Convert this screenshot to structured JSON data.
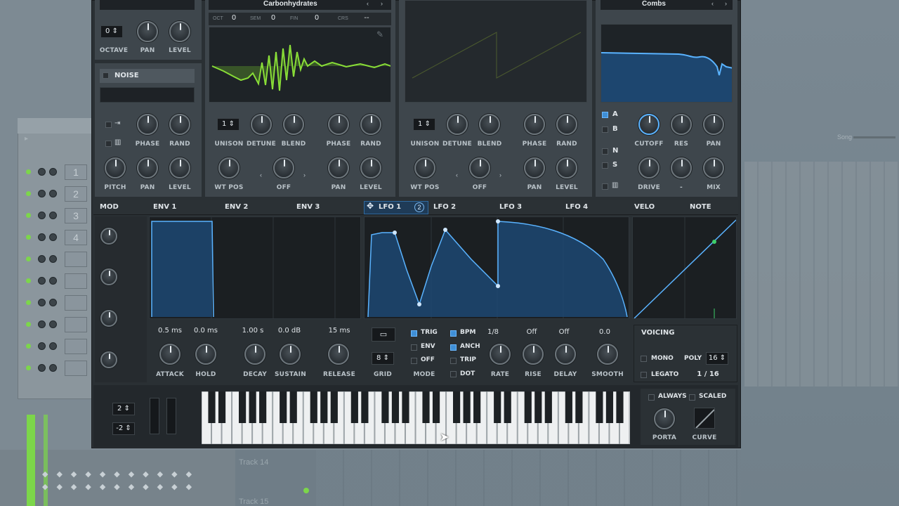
{
  "osc_a": {
    "wavetable_name": "Carbonhydrates",
    "oct_label": "OCT",
    "oct_val": "0",
    "sem_label": "SEM",
    "sem_val": "0",
    "fin_label": "FIN",
    "fin_val": "0",
    "crs_label": "CRS",
    "crs_val": "--",
    "unison": "1",
    "labels": {
      "unison": "UNISON",
      "detune": "DETUNE",
      "blend": "BLEND",
      "phase": "PHASE",
      "rand": "RAND",
      "wtpos": "WT POS",
      "off": "OFF",
      "pan": "PAN",
      "level": "LEVEL"
    }
  },
  "osc_b": {
    "unison": "1",
    "labels": {
      "unison": "UNISON",
      "detune": "DETUNE",
      "blend": "BLEND",
      "phase": "PHASE",
      "rand": "RAND",
      "wtpos": "WT POS",
      "off": "OFF",
      "pan": "PAN",
      "level": "LEVEL"
    }
  },
  "sub": {
    "octave_val": "0",
    "octave": "OCTAVE",
    "pan": "PAN",
    "level": "LEVEL"
  },
  "noise": {
    "title": "NOISE",
    "phase": "PHASE",
    "rand": "RAND",
    "pitch": "PITCH",
    "pan": "PAN",
    "level": "LEVEL"
  },
  "filter": {
    "type": "Combs",
    "a": "A",
    "b": "B",
    "n": "N",
    "s": "S",
    "cutoff": "CUTOFF",
    "res": "RES",
    "pan": "PAN",
    "drive": "DRIVE",
    "dash": "-",
    "mix": "MIX"
  },
  "mod_tabs": {
    "mod": "MOD",
    "env1": "ENV 1",
    "env2": "ENV 2",
    "env3": "ENV 3",
    "lfo1": "LFO 1",
    "lfo1_badge": "2",
    "lfo2": "LFO 2",
    "lfo3": "LFO 3",
    "lfo4": "LFO 4",
    "velo": "VELO",
    "note": "NOTE"
  },
  "env": {
    "attack_val": "0.5 ms",
    "hold_val": "0.0 ms",
    "decay_val": "1.00 s",
    "sustain_val": "0.0 dB",
    "release_val": "15 ms",
    "attack": "ATTACK",
    "hold": "HOLD",
    "decay": "DECAY",
    "sustain": "SUSTAIN",
    "release": "RELEASE"
  },
  "lfo": {
    "grid_val": "8",
    "grid": "GRID",
    "trig": "TRIG",
    "env": "ENV",
    "off": "OFF",
    "mode": "MODE",
    "bpm": "BPM",
    "anch": "ANCH",
    "trip": "TRIP",
    "dot": "DOT",
    "rate_val": "1/8",
    "rise_val": "Off",
    "delay_val": "Off",
    "smooth_val": "0.0",
    "rate": "RATE",
    "rise": "RISE",
    "delay": "DELAY",
    "smooth": "SMOOTH"
  },
  "voicing": {
    "title": "VOICING",
    "mono": "MONO",
    "poly": "POLY",
    "poly_val": "16",
    "legato": "LEGATO",
    "voices": "1  /  16"
  },
  "keys": {
    "oct_up": "2",
    "oct_down": "-2",
    "always": "ALWAYS",
    "scaled": "SCALED",
    "porta": "PORTA",
    "curve": "CURVE"
  },
  "daw": {
    "track14": "Track 14",
    "track15": "Track 15",
    "song": "Song",
    "pads": [
      "1",
      "2",
      "3",
      "4"
    ]
  },
  "colors": {
    "accent": "#5ab3ff",
    "wave": "#8fe63a"
  }
}
